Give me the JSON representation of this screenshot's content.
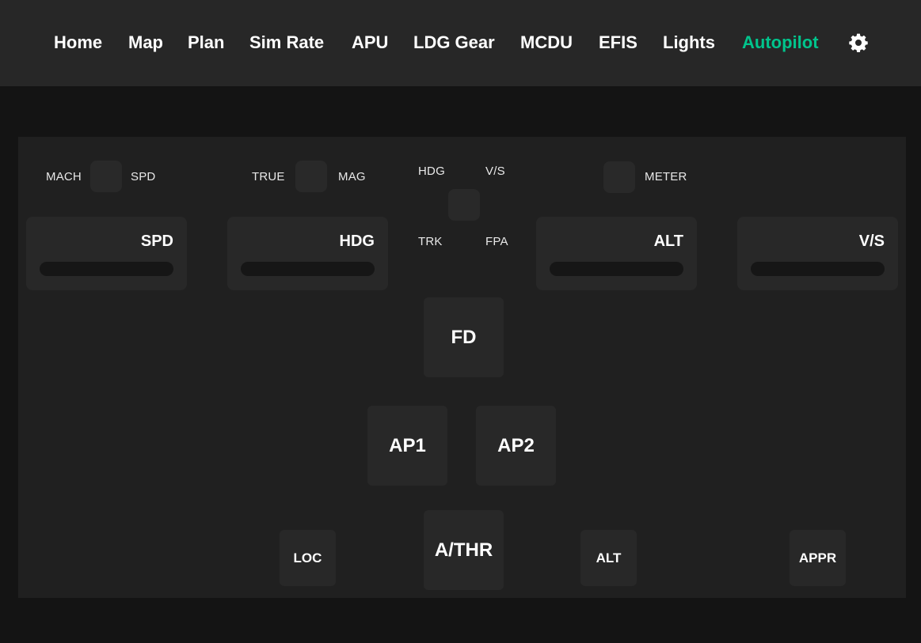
{
  "nav": {
    "items": [
      {
        "label": "Home"
      },
      {
        "label": "Map"
      },
      {
        "label": "Plan"
      },
      {
        "label": "Sim Rate"
      },
      {
        "label": "APU"
      },
      {
        "label": "LDG Gear"
      },
      {
        "label": "MCDU"
      },
      {
        "label": "EFIS"
      },
      {
        "label": "Lights"
      },
      {
        "label": "Autopilot"
      }
    ],
    "active": "Autopilot",
    "settings_icon": "gear-icon"
  },
  "colors": {
    "active_tab": "#00c48c",
    "nav_background": "#272727",
    "page_background": "#141414",
    "panel_background": "#202020",
    "control_background": "#282828"
  },
  "autopilot": {
    "speed_toggle": {
      "left": "MACH",
      "right": "SPD"
    },
    "heading_toggle": {
      "left": "TRUE",
      "right": "MAG"
    },
    "mode_toggle": {
      "top_left": "HDG",
      "top_right": "V/S",
      "bottom_left": "TRK",
      "bottom_right": "FPA"
    },
    "altitude_toggle": {
      "right": "METER"
    },
    "knobs": {
      "spd": "SPD",
      "hdg": "HDG",
      "alt": "ALT",
      "vs": "V/S"
    },
    "buttons": {
      "fd": "FD",
      "ap1": "AP1",
      "ap2": "AP2",
      "athr": "A/THR",
      "loc": "LOC",
      "alt": "ALT",
      "appr": "APPR"
    }
  }
}
